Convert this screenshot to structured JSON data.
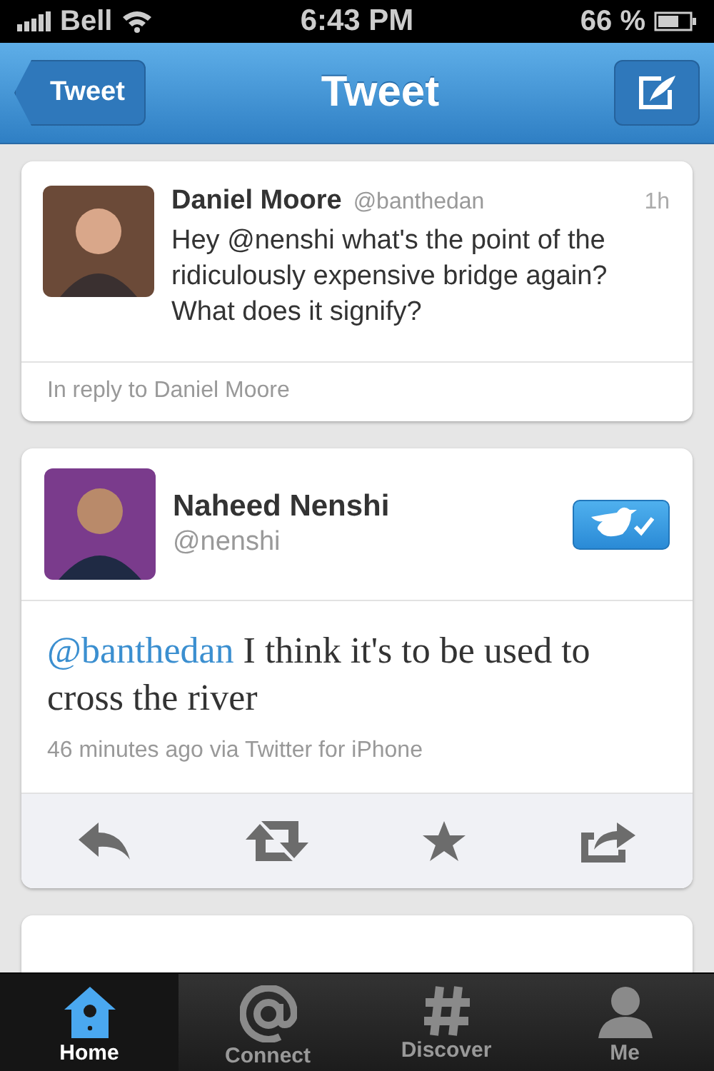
{
  "status_bar": {
    "carrier": "Bell",
    "time": "6:43 PM",
    "battery": "66 %"
  },
  "nav_bar": {
    "back": "Tweet",
    "title": "Tweet"
  },
  "reply_tweet": {
    "name": "Daniel Moore",
    "handle": "@banthedan",
    "age": "1h",
    "text": "Hey @nenshi what's the point of the ridiculously expensive bridge again? What does it signify?",
    "in_reply_to": "In reply to Daniel Moore"
  },
  "main_tweet": {
    "name": "Naheed Nenshi",
    "handle": "@nenshi",
    "verified": true,
    "mention": "@banthedan",
    "text": "I think it's to be used to cross the river",
    "meta": "46 minutes ago via Twitter for iPhone"
  },
  "actions": [
    {
      "kind": "reply"
    },
    {
      "kind": "retweet"
    },
    {
      "kind": "favorite"
    },
    {
      "kind": "share"
    }
  ],
  "tabs": [
    {
      "label": "Home",
      "kind": "home",
      "selected": true
    },
    {
      "label": "Connect",
      "kind": "connect",
      "selected": false
    },
    {
      "label": "Discover",
      "kind": "discover",
      "selected": false
    },
    {
      "label": "Me",
      "kind": "me",
      "selected": false
    }
  ]
}
